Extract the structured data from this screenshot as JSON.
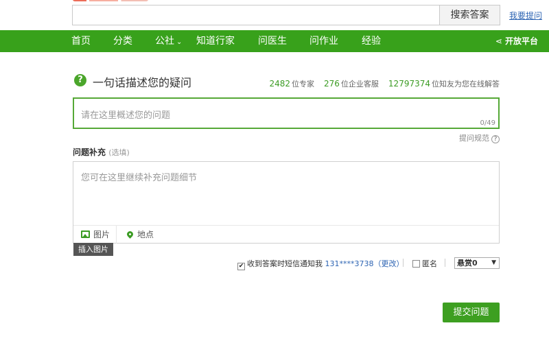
{
  "search": {
    "placeholder": "",
    "button_label": "搜索答案",
    "ask_link": "我要提问"
  },
  "nav": {
    "items": [
      "首页",
      "分类",
      "公社",
      "知道行家",
      "问医生",
      "问作业",
      "经验"
    ],
    "open_platform": "开放平台"
  },
  "question": {
    "title": "一句话描述您的疑问",
    "placeholder": "请在这里概述您的问题",
    "char_count": "0/49",
    "rules_link": "提问规范"
  },
  "stats": {
    "experts": "2482",
    "experts_label": "位专家",
    "enterprise": "276",
    "enterprise_label": "位企业客服",
    "friends": "12797374",
    "friends_label": "位知友为您在线解答"
  },
  "supplement": {
    "label": "问题补充",
    "optional": "(选填)",
    "placeholder": "您可在这里继续补充问题细节",
    "image_tool": "图片",
    "location_tool": "地点",
    "tooltip": "插入图片"
  },
  "options": {
    "sms_label": "收到答案时短信通知我",
    "phone": "131****3738",
    "change": "（更改）",
    "sms_checked": true,
    "anonymous_label": "匿名",
    "anonymous_checked": false,
    "reward_label": "悬赏0"
  },
  "submit_label": "提交问题",
  "colors": {
    "nav_green": "#38a11b",
    "accent_green": "#3d9f21",
    "link_blue": "#2d64b3"
  }
}
